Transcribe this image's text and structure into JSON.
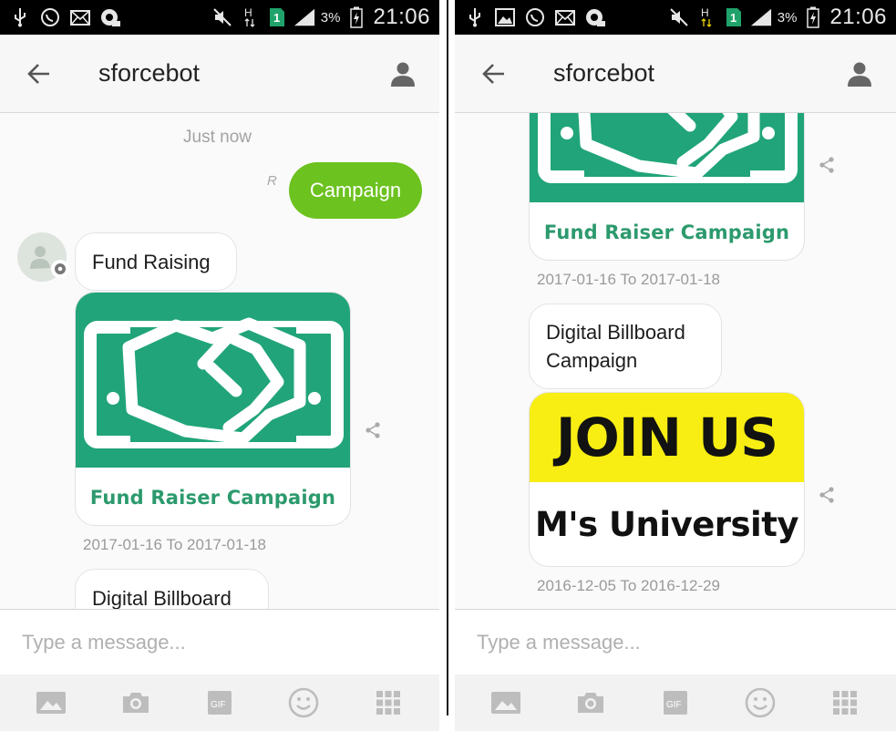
{
  "status_bar": {
    "battery_percent": "3%",
    "time": "21:06",
    "network_type": "H"
  },
  "screens": [
    {
      "header": {
        "title": "sforcebot"
      },
      "conversation": {
        "timestamp": "Just now",
        "read_receipt": "R",
        "sent_message": "Campaign",
        "received_text": "Fund Raising",
        "card": {
          "title": "Fund Raiser Campaign",
          "caption": "2017-01-16 To 2017-01-18"
        },
        "next_message_partial": "Digital Billboard"
      },
      "input": {
        "placeholder": "Type a message..."
      }
    },
    {
      "header": {
        "title": "sforcebot"
      },
      "conversation": {
        "card1": {
          "title": "Fund Raiser Campaign",
          "caption": "2017-01-16 To 2017-01-18"
        },
        "message_line1": "Digital Billboard",
        "message_line2": "Campaign",
        "card2": {
          "headline": "JOIN US",
          "subline": "M's University",
          "caption": "2016-12-05 To 2016-12-29"
        }
      },
      "input": {
        "placeholder": "Type a message..."
      }
    }
  ],
  "bottom_bar": {
    "items": [
      "image-icon",
      "camera-icon",
      "gif-icon",
      "emoji-icon",
      "apps-grid-icon"
    ],
    "gif_label": "GIF"
  },
  "colors": {
    "accent_green": "#6cc21f",
    "card_green": "#21a47a",
    "title_green": "#2c9a6d",
    "billboard_yellow": "#f8ee13"
  }
}
